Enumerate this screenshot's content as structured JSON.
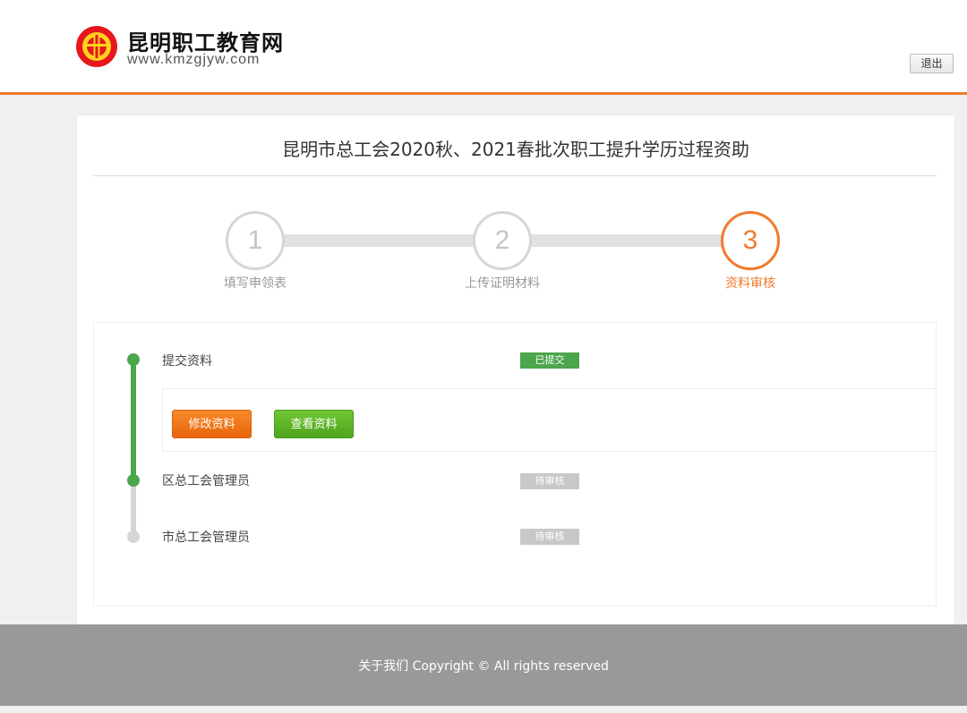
{
  "header": {
    "brand_name": "昆明职工教育网",
    "brand_url": "www.kmzgjyw.com",
    "logout_label": "退出",
    "accent_color": "#f07a2e"
  },
  "main": {
    "title": "昆明市总工会2020秋、2021春批次职工提升学历过程资助",
    "steps": [
      {
        "number": "1",
        "label": "填写申领表",
        "state": "done"
      },
      {
        "number": "2",
        "label": "上传证明材料",
        "state": "done"
      },
      {
        "number": "3",
        "label": "资料审核",
        "state": "active"
      }
    ],
    "progress": [
      {
        "label": "提交资料",
        "status": "已提交",
        "status_color": "#4ca64c"
      },
      {
        "label": "区总工会管理员",
        "status": "待审核",
        "status_color": "#c8c8c8"
      },
      {
        "label": "市总工会管理员",
        "status": "待审核",
        "status_color": "#c8c8c8"
      }
    ],
    "actions": {
      "edit_label": "修改资料",
      "view_label": "查看资料"
    }
  },
  "footer": {
    "text": "关于我们 Copyright © All rights reserved"
  }
}
